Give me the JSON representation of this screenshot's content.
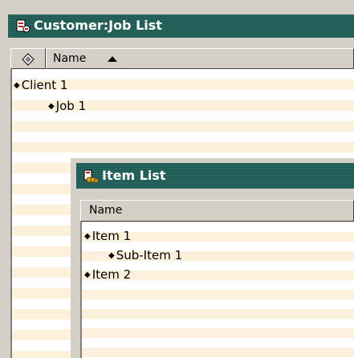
{
  "customer_job_window": {
    "title": "Customer:Job List",
    "columns": {
      "marker_icon": "diamond-icon",
      "name": "Name",
      "sort": "ascending"
    },
    "rows": [
      {
        "label": "Client 1",
        "level": 0
      },
      {
        "label": "Job 1",
        "level": 1
      }
    ]
  },
  "item_window": {
    "title": "Item List",
    "columns": {
      "name": "Name"
    },
    "rows": [
      {
        "label": "Item 1",
        "level": 0
      },
      {
        "label": "Sub-Item 1",
        "level": 1
      },
      {
        "label": "Item 2",
        "level": 0
      }
    ]
  },
  "colors": {
    "titlebar": "#27645d",
    "stripe": "#fdf1dc",
    "chrome": "#d4d0c8"
  }
}
